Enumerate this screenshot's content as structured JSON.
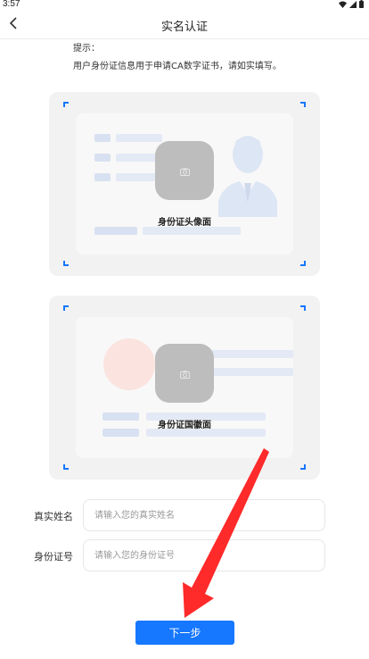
{
  "status_bar": {
    "time": "3:57"
  },
  "nav": {
    "title": "实名认证"
  },
  "hint": {
    "title": "提示：",
    "text": "用户身份证信息用于申请CA数字证书，请如实填写。"
  },
  "cards": {
    "front_label": "身份证头像面",
    "back_label": "身份证国徽面"
  },
  "form": {
    "name_label": "真实姓名",
    "name_placeholder": "请输入您的真实姓名",
    "name_value": "",
    "id_label": "身份证号",
    "id_placeholder": "请输入您的身份证号",
    "id_value": ""
  },
  "next_button": {
    "label": "下一步"
  },
  "colors": {
    "accent": "#1677ff",
    "annotation_arrow": "#ff2a2a"
  },
  "icons": {
    "back": "chevron-left-icon",
    "camera": "camera-icon",
    "wifi": "wifi-icon",
    "signal": "signal-icon",
    "battery": "battery-icon"
  }
}
